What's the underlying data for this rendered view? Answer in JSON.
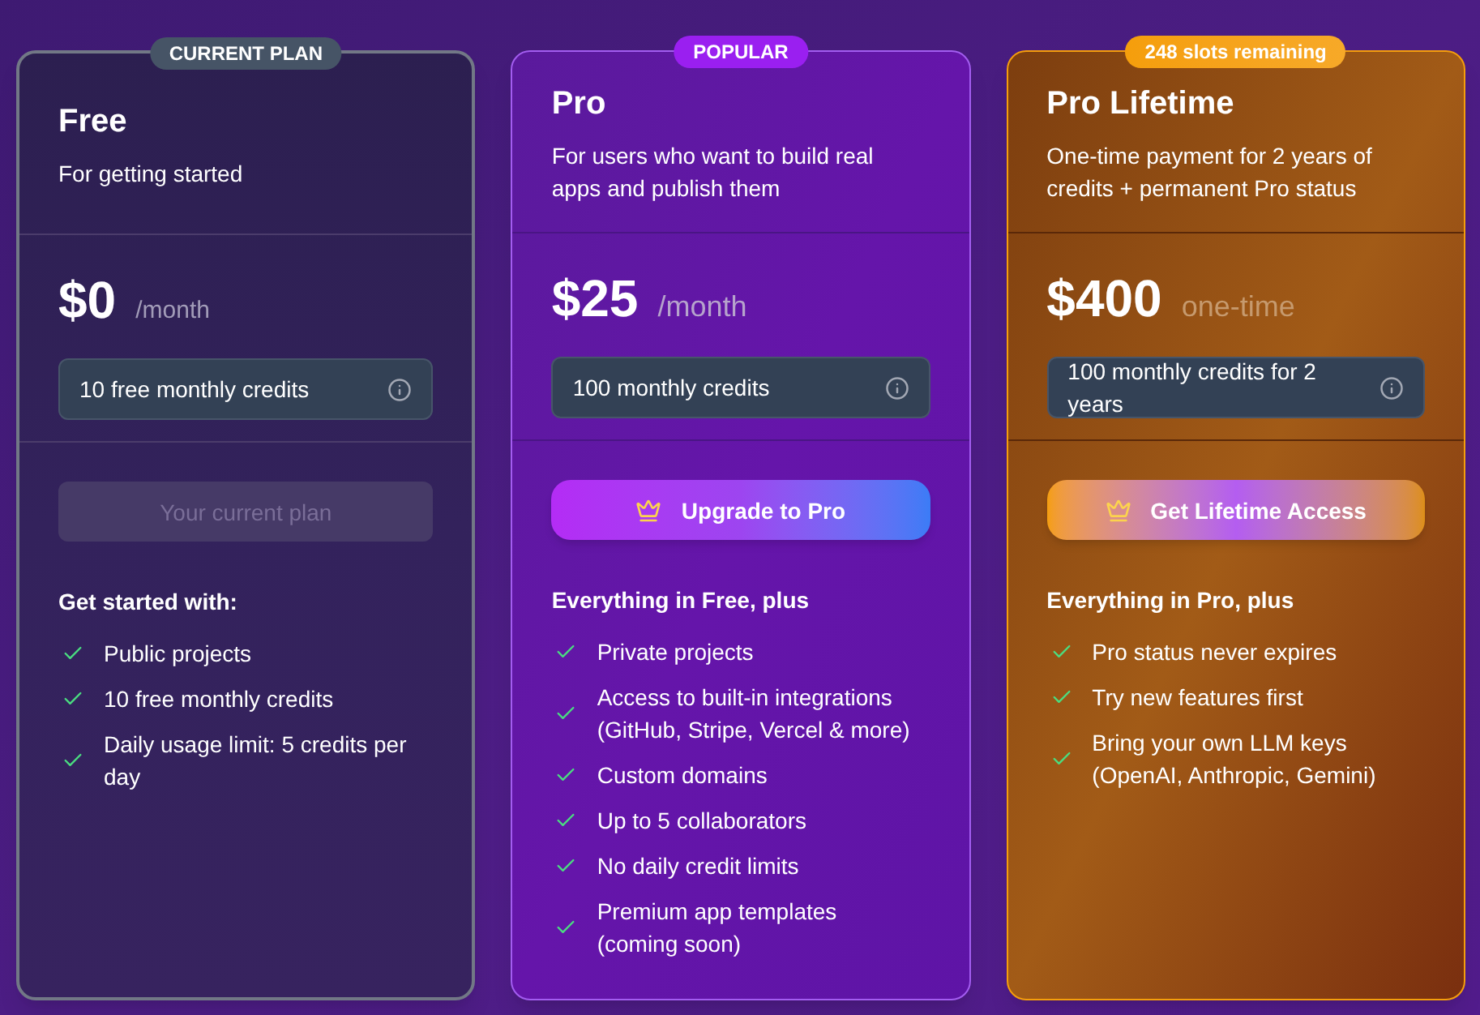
{
  "plans": [
    {
      "kind": "current",
      "badge": "CURRENT PLAN",
      "name": "Free",
      "description": "For getting started",
      "price": "$0",
      "period": "/month",
      "credits": "10 free monthly credits",
      "button": {
        "label": "Your current plan",
        "disabled": true
      },
      "features_title": "Get started with:",
      "features": [
        "Public projects",
        "10 free monthly credits",
        "Daily usage limit: 5 credits per day"
      ]
    },
    {
      "kind": "popular",
      "badge": "POPULAR",
      "name": "Pro",
      "description": "For users who want to build real apps and publish them",
      "price": "$25",
      "period": "/month",
      "credits": "100 monthly credits",
      "button": {
        "label": "Upgrade to Pro",
        "disabled": false
      },
      "features_title": "Everything in Free, plus",
      "features": [
        "Private projects",
        "Access to built-in integrations (GitHub, Stripe, Vercel & more)",
        "Custom domains",
        "Up to 5 collaborators",
        "No daily credit limits",
        "Premium app templates (coming soon)"
      ]
    },
    {
      "kind": "lifetime",
      "badge": "248 slots remaining",
      "name": "Pro Lifetime",
      "description": "One-time payment for 2 years of credits + permanent Pro status",
      "price": "$400",
      "period": "one-time",
      "credits": "100 monthly credits for 2 years",
      "button": {
        "label": "Get Lifetime Access",
        "disabled": false
      },
      "features_title": "Everything in Pro, plus",
      "features": [
        "Pro status never expires",
        "Try new features first",
        "Bring your own LLM keys (OpenAI, Anthropic, Gemini)"
      ]
    }
  ]
}
